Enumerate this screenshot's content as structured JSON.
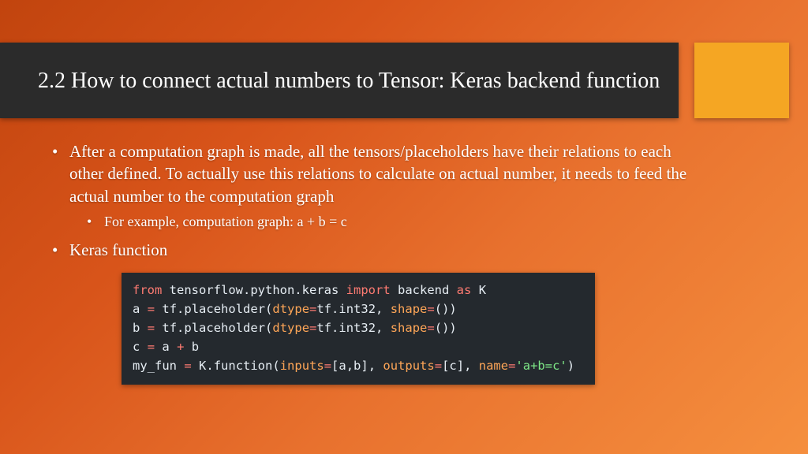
{
  "title": "2.2 How to connect actual numbers to Tensor: Keras backend function",
  "bullets": {
    "b1": "After a computation graph is made, all the tensors/placeholders have their relations to each other defined. To actually use this relations to calculate on actual number, it needs to feed the actual number to the computation graph",
    "b1a": "For example, computation graph: a + b = c",
    "b2": "Keras function"
  },
  "code": {
    "l1": {
      "kw1": "from",
      "mod": "tensorflow.python.keras",
      "kw2": "import",
      "what": "backend",
      "kw3": "as",
      "alias": "K"
    },
    "l2": {
      "lhs": "a",
      "eq": "=",
      "call": "tf.placeholder",
      "lp": "(",
      "arg1": "dtype",
      "eq1": "=",
      "val1": "tf.int32",
      "comma": ", ",
      "arg2": "shape",
      "eq2": "=",
      "val2": "()",
      "rp": ")"
    },
    "l3": {
      "lhs": "b",
      "eq": "=",
      "call": "tf.placeholder",
      "lp": "(",
      "arg1": "dtype",
      "eq1": "=",
      "val1": "tf.int32",
      "comma": ", ",
      "arg2": "shape",
      "eq2": "=",
      "val2": "()",
      "rp": ")"
    },
    "l4": {
      "lhs": "c",
      "eq": "=",
      "a": "a",
      "plus": "+",
      "b": "b"
    },
    "l5": {
      "lhs": "my_fun",
      "eq": "=",
      "call": "K.function",
      "lp": "(",
      "arg1": "inputs",
      "eq1": "=",
      "val1": "[a,b]",
      "comma1": ", ",
      "arg2": "outputs",
      "eq2": "=",
      "val2": "[c]",
      "comma2": ", ",
      "arg3": "name",
      "eq3": "=",
      "val3": "'a+b=c'",
      "rp": ")"
    }
  }
}
